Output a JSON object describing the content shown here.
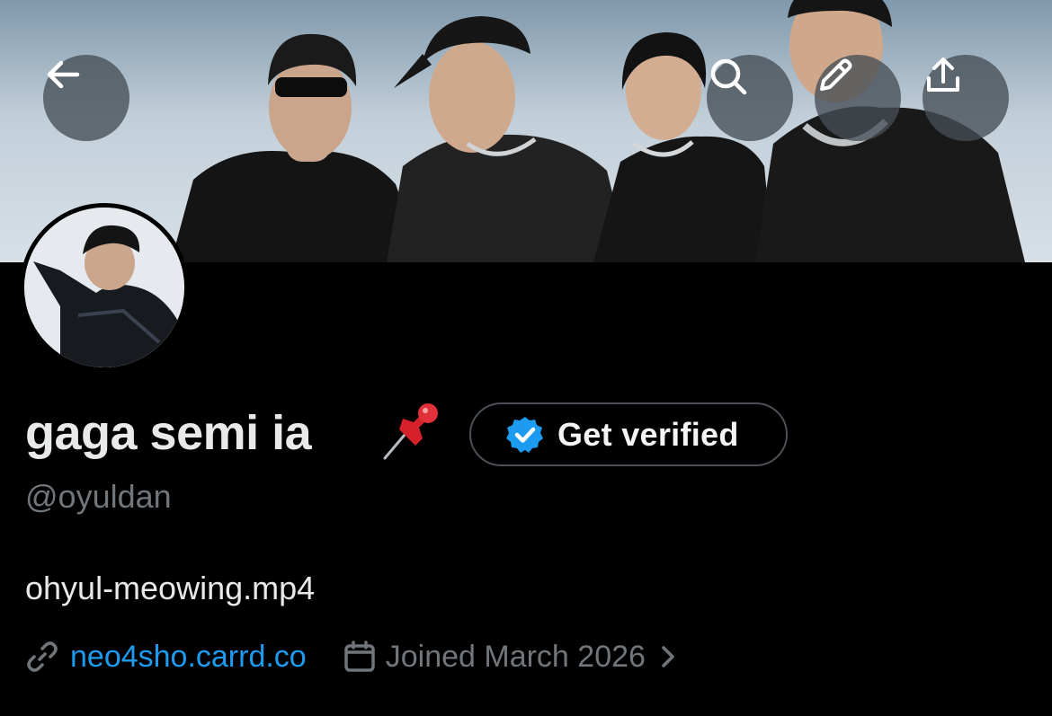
{
  "profile": {
    "name": "gaga semi ia",
    "name_emoji_icon": "pushpin-icon",
    "handle": "@oyuldan",
    "bio": "ohyul-meowing.mp4",
    "link": "neo4sho.carrd.co",
    "joined": "Joined March 2026"
  },
  "actions": {
    "get_verified_label": "Get verified"
  },
  "icons": {
    "back": "back-arrow-icon",
    "search": "search-icon",
    "edit": "pencil-icon",
    "share": "share-icon",
    "link": "link-icon",
    "calendar": "calendar-icon",
    "chevron": "chevron-right-icon",
    "verified": "verified-badge-icon"
  },
  "colors": {
    "background": "#000000",
    "accent": "#1d9bf0",
    "muted": "#71767b",
    "text": "#e7e9ea"
  }
}
